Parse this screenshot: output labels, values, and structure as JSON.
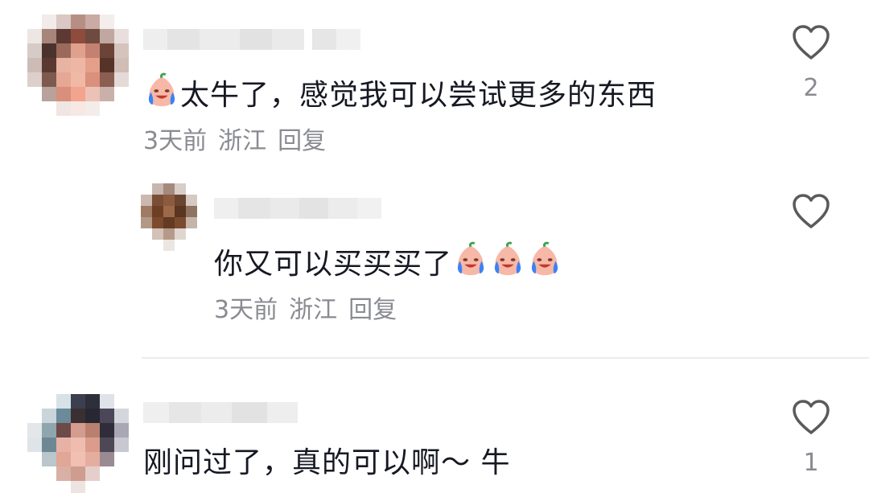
{
  "comments": [
    {
      "text": "太牛了，感觉我可以尝试更多的东西",
      "time": "3天前",
      "location": "浙江",
      "reply_label": "回复",
      "likes": "2",
      "emoji_prefix": "crying-laughing-peach-emoji",
      "replies": [
        {
          "text": "你又可以买买买了",
          "time": "3天前",
          "location": "浙江",
          "reply_label": "回复",
          "likes": "",
          "emoji_suffix_count": 3
        }
      ]
    },
    {
      "text": "刚问过了，真的可以啊～ 牛",
      "likes": "1"
    }
  ],
  "colors": {
    "text": "#161823",
    "meta": "#8a8b91",
    "heart_outline": "#5a5a5a",
    "divider": "#ececec"
  },
  "icons": {
    "like": "heart-outline-icon",
    "emoji": "crying-laughing-peach-emoji"
  }
}
